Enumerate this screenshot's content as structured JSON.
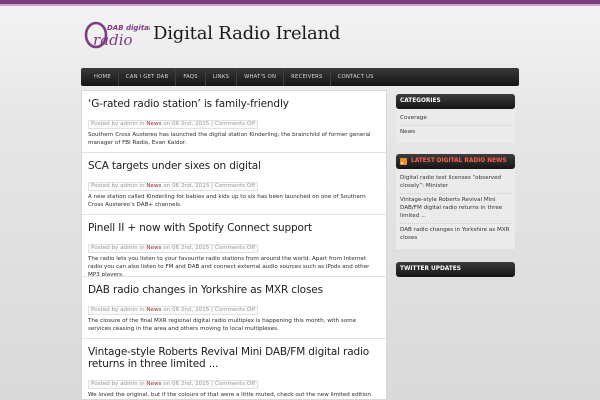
{
  "site": {
    "logo_top": "DAB digital",
    "logo_main": "radio",
    "title": "Digital Radio Ireland"
  },
  "colors": {
    "brand_purple": "#7e3b80",
    "category_red": "#a12c2c",
    "nav_dark": "#1f1f1f",
    "rss_orange": "#f08a23"
  },
  "nav": {
    "items": [
      "HOME",
      "CAN I GET DAB",
      "FAQS",
      "LINKS",
      "WHAT'S ON",
      "RECEIVERS",
      "CONTACT US"
    ]
  },
  "meta": {
    "posted_by": "Posted by admin in",
    "category": "News",
    "date": "on 06 2nd, 2015",
    "comments": "Comments Off"
  },
  "posts": [
    {
      "title": "‘G-rated radio station’ is family-friendly",
      "excerpt": "Southern Cross Austereo has launched the digital station Kinderling, the brainchild of former general manager of FBi Radio, Evan Kaldor."
    },
    {
      "title": "SCA targets under sixes on digital",
      "excerpt": "A new station called Kinderling for babies and kids up to six has been launched on one of Southern Cross Austereo’s DAB+ channels."
    },
    {
      "title": "Pinell II + now with Spotify Connect support",
      "excerpt": "The radio lets you listen to your favourite radio stations from around the world. Apart from Internet radio you can also listen to FM and DAB and connect external audio sources such as iPods and other MP3 players."
    },
    {
      "title": "DAB radio changes in Yorkshire as MXR closes",
      "excerpt": "The closure of the final MXR regional digital radio multiplex is happening this month, with some services ceasing in the area and others moving to local multiplexes."
    },
    {
      "title": "Vintage-style Roberts Revival Mini DAB/FM digital radio returns in three limited ...",
      "excerpt": "We loved the original, but if the colours of that were a little muted, check out the new limited edition shades of the Roberts Revival Mini DAB/FM digital radio."
    }
  ],
  "sidebar": {
    "categories": {
      "title": "CATEGORIES",
      "items": [
        "Coverage",
        "News"
      ]
    },
    "latest_news": {
      "title": "LATEST DIGITAL RADIO NEWS",
      "icon": "rss-icon",
      "items": [
        "Digital radio test licenses “observed closely”: Minister",
        "Vintage-style Roberts Revival Mini DAB/FM digital radio returns in three limited ...",
        "DAB radio changes in Yorkshire as MXR closes"
      ]
    },
    "twitter": {
      "title": "TWITTER UPDATES"
    }
  }
}
